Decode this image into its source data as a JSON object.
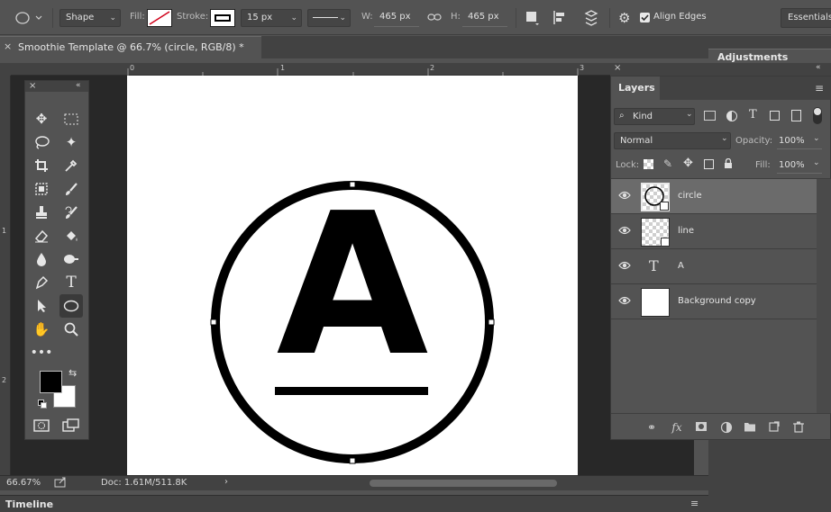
{
  "options_bar": {
    "shape_mode": "Shape",
    "fill_label": "Fill:",
    "stroke_label": "Stroke:",
    "stroke_width": "15 px",
    "w_label": "W:",
    "w_value": "465 px",
    "h_label": "H:",
    "h_value": "465 px",
    "align_edges_label": "Align Edges",
    "align_edges_checked": true,
    "workspace": "Essentials"
  },
  "document": {
    "tab_title": "Smoothie Template @ 66.7% (circle, RGB/8) *",
    "ruler_h_ticks": [
      "0",
      "1",
      "2",
      "3"
    ],
    "ruler_v_ticks": [
      "1",
      "2"
    ],
    "zoom": "66.67%",
    "doc_info": "Doc: 1.61M/511.8K",
    "canvas_letter": "A"
  },
  "timeline": {
    "title": "Timeline"
  },
  "adjustments": {
    "title": "Adjustments"
  },
  "layers_panel": {
    "title": "Layers",
    "filter_kind": "Kind",
    "blend_mode": "Normal",
    "opacity_label": "Opacity:",
    "opacity_value": "100%",
    "lock_label": "Lock:",
    "fill_label": "Fill:",
    "fill_value": "100%",
    "layers": [
      {
        "name": "circle",
        "type": "shape",
        "selected": true
      },
      {
        "name": "line",
        "type": "shape",
        "selected": false
      },
      {
        "name": "A",
        "type": "text",
        "selected": false
      },
      {
        "name": "Background copy",
        "type": "pixel",
        "selected": false
      }
    ]
  },
  "colors": {
    "foreground": "#000000",
    "background": "#ffffff",
    "fill_none_slash": "#d0021b"
  }
}
